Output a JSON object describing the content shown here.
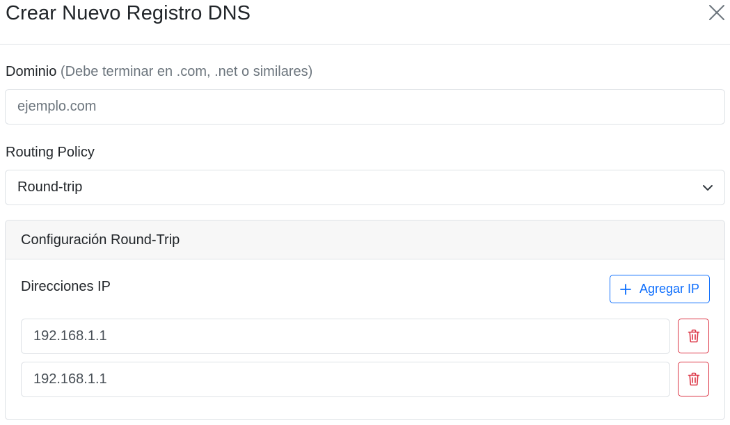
{
  "modal": {
    "title": "Crear Nuevo Registro DNS",
    "close_icon": "close-icon"
  },
  "domain": {
    "label": "Dominio",
    "hint": "(Debe terminar en .com, .net o similares)",
    "placeholder": "ejemplo.com"
  },
  "routing": {
    "label": "Routing Policy",
    "selected": "Round-trip",
    "icon": "chevron-down-icon"
  },
  "config": {
    "header": "Configuración Round-Trip",
    "ip_label": "Direcciones IP",
    "add_button": "Agregar IP",
    "add_icon": "plus-icon",
    "delete_icon": "trash-icon",
    "ips": [
      "192.168.1.1",
      "192.168.1.1"
    ]
  },
  "colors": {
    "primary": "#0d6efd",
    "danger": "#dc3545",
    "muted": "#6c757d",
    "border": "#dee2e6",
    "card_header_bg": "#f7f7f7"
  }
}
